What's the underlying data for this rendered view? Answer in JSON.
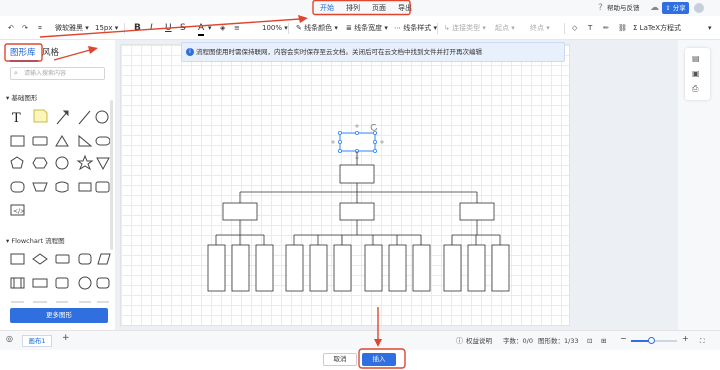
{
  "topbar": {
    "tabs": [
      "开始",
      "排列",
      "页面",
      "导出"
    ],
    "active_tab": "开始",
    "help_label": "帮助与反馈",
    "share_label": "分享"
  },
  "toolbar": {
    "font_family": "微软雅黑",
    "font_size": "15px",
    "bold": "B",
    "italic": "I",
    "underline": "U",
    "strike": "S",
    "font_color": "A",
    "zoom": "100%",
    "line_color": "线条颜色",
    "line_width": "线条宽度",
    "line_style": "线条样式",
    "connector_type": "连接类型",
    "start": "起点",
    "end": "终点",
    "latex": "LaTeX方程式"
  },
  "left_panel": {
    "tab_shapes": "图形库",
    "tab_style": "风格",
    "search_placeholder": "请输入搜索内容",
    "section_basic": "基础图形",
    "section_flowchart": "Flowchart 流程图",
    "text_glyph": "T",
    "more_shapes": "更多图形"
  },
  "notice": {
    "text": "流程图使用时需保持联网，内容会实时保存至云文档。关闭后可在云文档中找到文件并打开再次编辑"
  },
  "statusbar": {
    "page_tab": "画布1",
    "add_page": "+",
    "rights": "权益说明",
    "word_count": "字数：0/0",
    "shape_count": "图形数：1/33",
    "zoom_percent": 0.45
  },
  "footer": {
    "cancel": "取消",
    "insert": "插入"
  },
  "colors": {
    "accent": "#2f6fe0",
    "annotation": "#e0462f",
    "selection": "#2f83f5"
  },
  "icons": [
    "undo-icon",
    "redo-icon",
    "format-painter-icon",
    "help-icon",
    "cloud-icon",
    "share-icon",
    "search-icon",
    "info-icon",
    "outline-icon",
    "image-icon",
    "print-icon",
    "layers-icon",
    "zoom-out-icon",
    "zoom-in-icon",
    "fullscreen-icon",
    "chevron-down-icon",
    "link-icon",
    "edit-icon",
    "clear-icon"
  ]
}
